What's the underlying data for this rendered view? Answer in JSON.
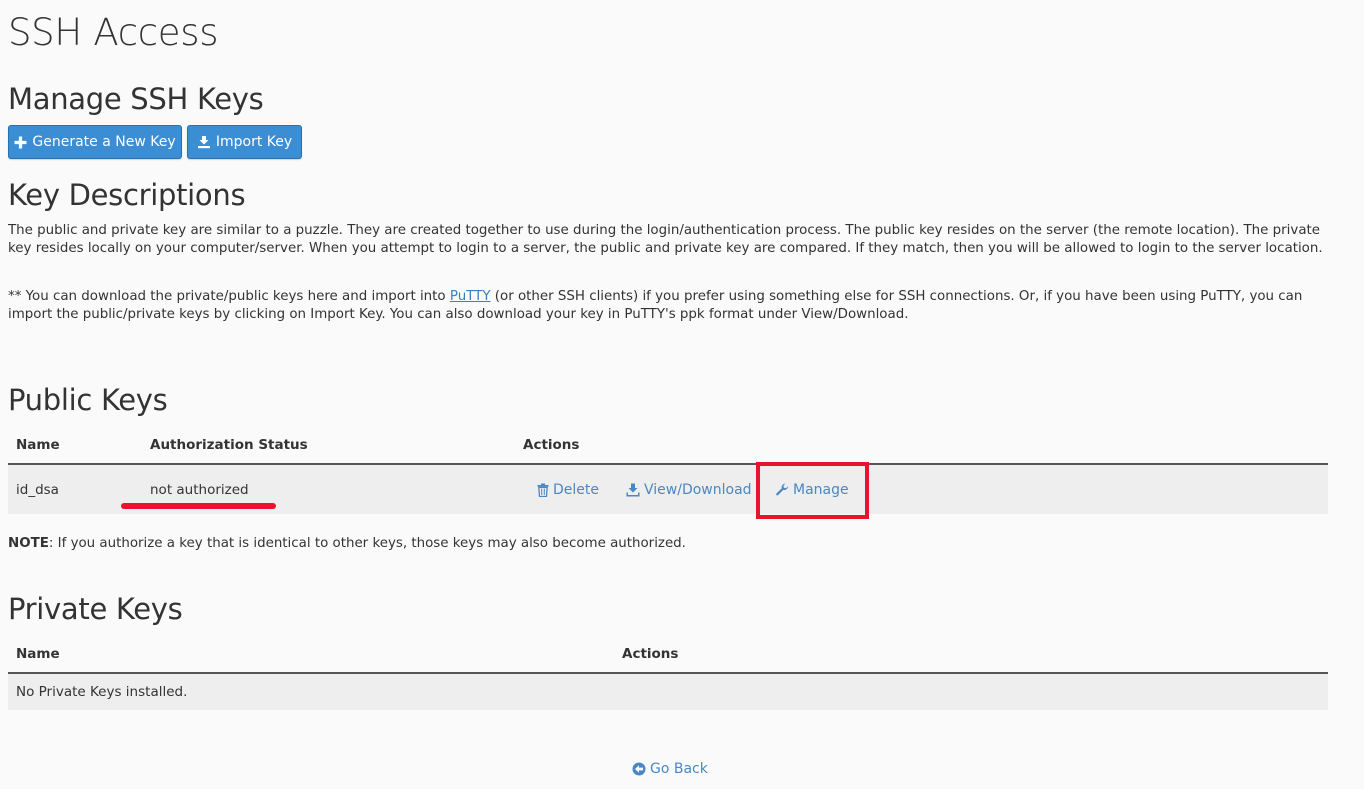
{
  "page": {
    "title": "SSH Access"
  },
  "manage_keys": {
    "heading": "Manage SSH Keys",
    "generate_label": "Generate a New Key",
    "import_label": "Import Key"
  },
  "key_descriptions": {
    "heading": "Key Descriptions",
    "paragraph1": "The public and private key are similar to a puzzle. They are created together to use during the login/authentication process. The public key resides on the server (the remote location). The private key resides locally on your computer/server. When you attempt to login to a server, the public and private key are compared. If they match, then you will be allowed to login to the server location.",
    "paragraph2_prefix": "** You can download the private/public keys here and import into ",
    "paragraph2_link": "PuTTY",
    "paragraph2_suffix": " (or other SSH clients) if you prefer using something else for SSH connections. Or, if you have been using PuTTY, you can import the public/private keys by clicking on Import Key. You can also download your key in PuTTY's ppk format under View/Download."
  },
  "public_keys": {
    "heading": "Public Keys",
    "columns": {
      "name": "Name",
      "status": "Authorization Status",
      "actions": "Actions"
    },
    "rows": [
      {
        "name": "id_dsa",
        "status": "not authorized",
        "delete_label": "Delete",
        "view_label": "View/Download",
        "manage_label": "Manage"
      }
    ],
    "note_label": "NOTE",
    "note_text": ": If you authorize a key that is identical to other keys, those keys may also become authorized."
  },
  "private_keys": {
    "heading": "Private Keys",
    "columns": {
      "name": "Name",
      "actions": "Actions"
    },
    "empty_message": "No Private Keys installed."
  },
  "footer": {
    "go_back_label": "Go Back"
  },
  "colors": {
    "button_blue": "#3b8dd4",
    "link_blue": "#4a87c4",
    "annotation_red": "#e8132c",
    "row_gray": "#eeeeee"
  },
  "icons": {
    "generate": "plus-icon",
    "import": "import-icon",
    "delete": "trash-icon",
    "view": "download-icon",
    "manage": "wrench-icon",
    "go_back": "arrow-circle-left-icon"
  }
}
